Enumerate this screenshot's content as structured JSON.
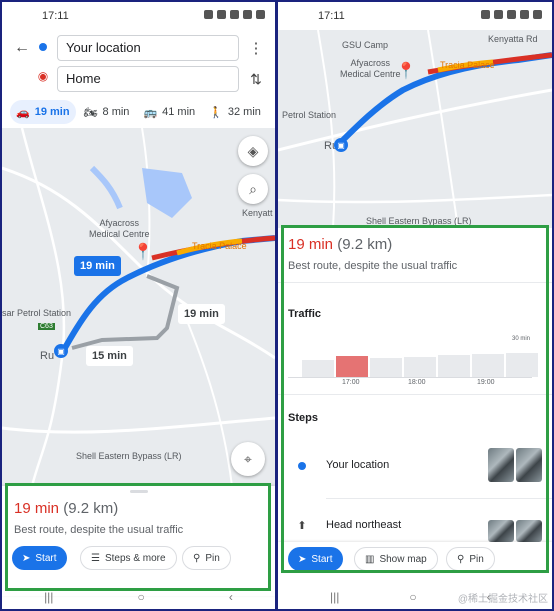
{
  "left": {
    "status_time": "17:11",
    "origin": "Your location",
    "destination": "Home",
    "modes": [
      {
        "icon": "car-icon",
        "label": "19 min",
        "active": true
      },
      {
        "icon": "motorcycle-icon",
        "label": "8 min",
        "active": false
      },
      {
        "icon": "bus-icon",
        "label": "41 min",
        "active": false
      },
      {
        "icon": "walk-icon",
        "label": "32 min",
        "active": false
      }
    ],
    "map_labels": {
      "kenyatta": "Kenyatt",
      "medical": "Afyacross\nMedical Centre",
      "palace": "Tracia Palace",
      "petrol": "sar Petrol Station",
      "c63": "C63",
      "ruiru": "Ru",
      "shell": "Shell Eastern Bypass (LR)"
    },
    "route_labels": {
      "main": "19 min",
      "alt1": "19 min",
      "alt2": "15 min"
    },
    "sheet": {
      "time": "19 min",
      "distance": "(9.2 km)",
      "desc": "Best route, despite the usual traffic",
      "start": "Start",
      "steps": "Steps & more",
      "pin": "Pin"
    }
  },
  "right": {
    "status_time": "17:11",
    "map_labels": {
      "gsu": "GSU Camp",
      "medical": "Afyacross\nMedical Centre",
      "palace": "Tracia Palace",
      "kenyatta": "Kenyatta Rd",
      "petrol": "Petrol Station",
      "ruiru": "Ru",
      "shell": "Shell Eastern Bypass (LR)"
    },
    "sheet": {
      "time": "19 min",
      "distance": "(9.2 km)",
      "desc": "Best route, despite the usual traffic",
      "traffic_title": "Traffic",
      "traffic_max": "30 min",
      "traffic_ticks": [
        "17:00",
        "18:00",
        "19:00"
      ],
      "traffic_levels": [
        0.55,
        0.7,
        0.62,
        0.68,
        0.72,
        0.78,
        0.8
      ],
      "steps_title": "Steps",
      "step1": "Your location",
      "step2": "Head northeast",
      "start": "Start",
      "show_map": "Show map",
      "pin": "Pin"
    }
  },
  "colors": {
    "route": "#4285f4",
    "traffic_red": "#d93025",
    "highlight": "#2e9e44",
    "accent": "#1a73e8"
  },
  "watermark": "@稀土掘金技术社区"
}
